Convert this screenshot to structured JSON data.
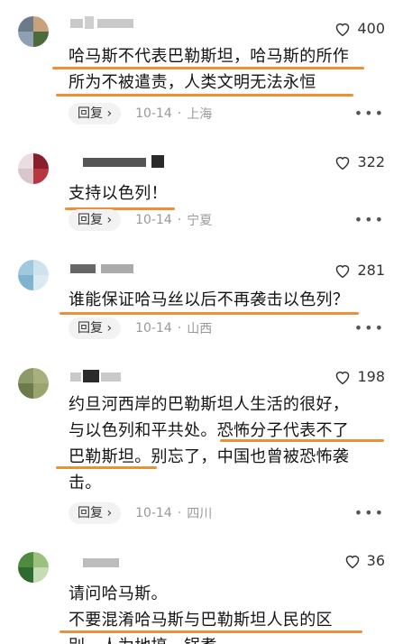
{
  "comments": [
    {
      "likes": "400",
      "lines": [
        "哈马斯不代表巴勒斯坦，哈马斯的所作",
        "所为不被遣责，人类文明无法永恒"
      ],
      "reply_label": "回复",
      "date": "10-14",
      "location": "上海",
      "avatar_colors": [
        "#6b7b8c",
        "#c9a27a",
        "#8fa0b5",
        "#4c6b3c"
      ]
    },
    {
      "likes": "322",
      "lines": [
        "支持以色列！"
      ],
      "reply_label": "回复",
      "date": "10-14",
      "location": "宁夏",
      "avatar_colors": [
        "#e9dde0",
        "#8a1e2f",
        "#d9c6cc",
        "#b8373f"
      ]
    },
    {
      "likes": "281",
      "lines": [
        "谁能保证哈马丝以后不再袭击以色列？"
      ],
      "reply_label": "回复",
      "date": "10-14",
      "location": "山西",
      "avatar_colors": [
        "#9fc9dd",
        "#cfe3ec",
        "#7fb3cf",
        "#dbeaf1"
      ]
    },
    {
      "likes": "198",
      "lines": [
        "约旦河西岸的巴勒斯坦人生活的很好，",
        "与以色列和平共处。恐怖分子代表不了",
        "巴勒斯坦。别忘了，中国也曾被恐怖袭",
        "击。"
      ],
      "reply_label": "回复",
      "date": "10-14",
      "location": "四川",
      "avatar_colors": [
        "#8c9a6a",
        "#a8b07d",
        "#6d7a4c",
        "#9aa56e"
      ]
    },
    {
      "likes": "36",
      "lines": [
        "请问哈马斯。",
        "不要混淆哈马斯与巴勒斯坦人民的区",
        "别，人为地搞一锅煮"
      ],
      "avatar_colors": [
        "#4f8a3e",
        "#9bc27c",
        "#2e6b2e",
        "#c7dcb4"
      ]
    }
  ],
  "colors": {
    "underline": "#e8913a",
    "meta": "#999999",
    "reply_bg": "#f2f2f2"
  },
  "icons": {
    "like": "heart-outline-icon",
    "more": "ellipsis-icon",
    "chevron": "chevron-right-icon"
  }
}
